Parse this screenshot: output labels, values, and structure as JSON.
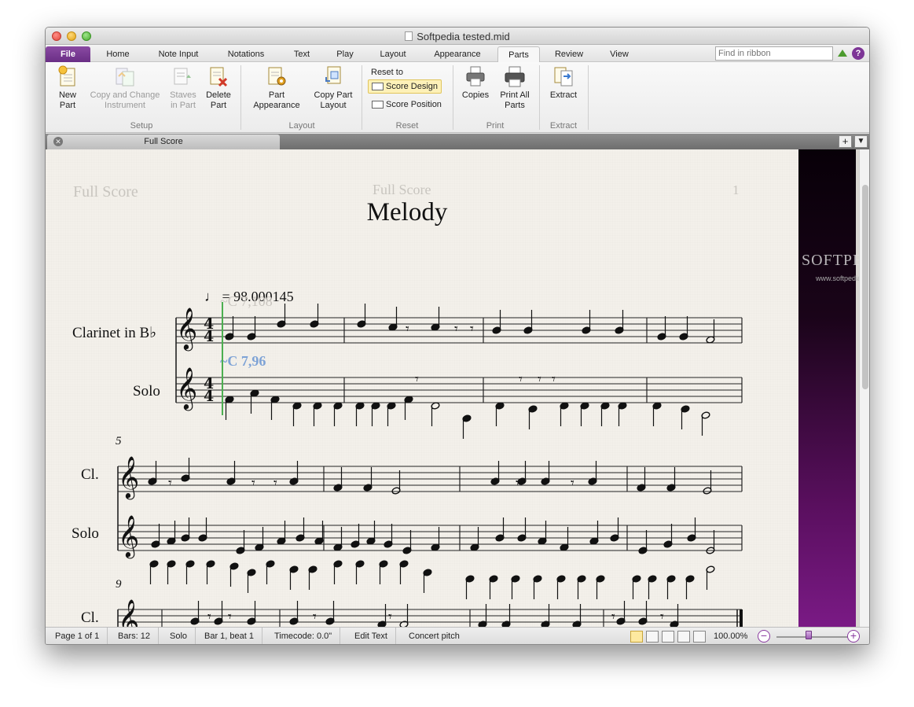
{
  "window": {
    "title": "Softpedia tested.mid"
  },
  "ribbon_tabs": [
    {
      "label": "File"
    },
    {
      "label": "Home"
    },
    {
      "label": "Note Input"
    },
    {
      "label": "Notations"
    },
    {
      "label": "Text"
    },
    {
      "label": "Play"
    },
    {
      "label": "Layout"
    },
    {
      "label": "Appearance"
    },
    {
      "label": "Parts",
      "active": true
    },
    {
      "label": "Review"
    },
    {
      "label": "View"
    }
  ],
  "search": {
    "placeholder": "Find in ribbon"
  },
  "ribbon": {
    "setup": {
      "label": "Setup",
      "new_part": "New\nPart",
      "copy_change": "Copy and Change\nInstrument",
      "staves_in_part": "Staves\nin Part",
      "delete_part": "Delete\nPart"
    },
    "layout": {
      "label": "Layout",
      "part_appearance": "Part\nAppearance",
      "copy_part_layout": "Copy Part\nLayout"
    },
    "reset": {
      "label": "Reset",
      "reset_to": "Reset to",
      "score_design": "Score Design",
      "score_position": "Score Position"
    },
    "print": {
      "label": "Print",
      "copies": "Copies",
      "print_all_parts": "Print All\nParts"
    },
    "extract": {
      "label": "Extract",
      "extract": "Extract"
    }
  },
  "document_tab": {
    "label": "Full Score"
  },
  "score": {
    "header_left": "Full Score",
    "header_center": "Full Score",
    "page_number": "1",
    "title": "Melody",
    "tempo": "= 98.000145",
    "tempo_note": "♩",
    "controller_faint": "~C 7,108",
    "controller_main": "~C 7,96",
    "instruments": {
      "clarinet": "Clarinet in B♭",
      "solo": "Solo",
      "cl_short": "Cl.",
      "solo_short": "Solo"
    },
    "measure_numbers": [
      "5",
      "9"
    ]
  },
  "watermark": {
    "text": "SOFTPEDIA",
    "url": "www.softpedia.com"
  },
  "status": {
    "page": "Page 1 of 1",
    "bars": "Bars: 12",
    "instrument": "Solo",
    "position": "Bar 1, beat 1",
    "timecode": "Timecode: 0.0\"",
    "mode": "Edit Text",
    "pitch": "Concert pitch",
    "zoom": "100.00%"
  },
  "colors": {
    "accent_purple": "#6a2e85",
    "controller_blue": "#7ea3d6",
    "playback_line": "#4caf50",
    "paper": "#f3f0ea"
  }
}
